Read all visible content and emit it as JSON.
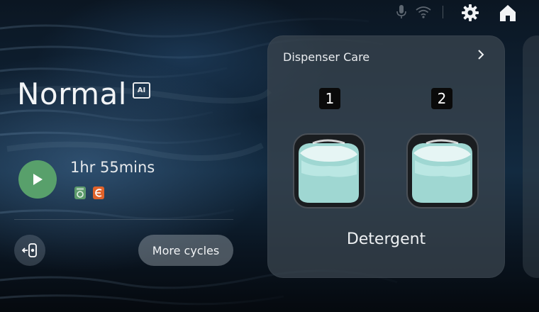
{
  "status_bar": {
    "icons": [
      "mic-icon",
      "wifi-icon",
      "gear-icon",
      "home-icon"
    ]
  },
  "cycle": {
    "name": "Normal",
    "ai_badge": "AI",
    "duration": "1hr 55mins",
    "option_icons": [
      "washer-icon",
      "ecobubble-icon"
    ]
  },
  "actions": {
    "more_cycles_label": "More cycles",
    "play_icon": "play-icon",
    "remote_icon": "remote-control-icon"
  },
  "dispenser_card": {
    "title": "Dispenser Care",
    "slots": [
      {
        "number": "1"
      },
      {
        "number": "2"
      }
    ],
    "label": "Detergent"
  },
  "colors": {
    "play_button": "#58a06b",
    "option_icon_green": "#5c9a6b",
    "option_icon_orange": "#e0622a",
    "card_background": "#3c4650"
  }
}
